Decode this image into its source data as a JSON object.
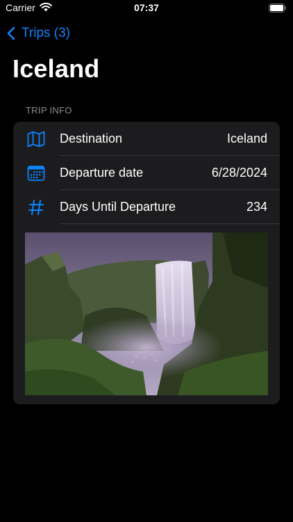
{
  "status_bar": {
    "carrier": "Carrier",
    "time": "07:37"
  },
  "nav": {
    "back_label": "Trips (3)"
  },
  "page": {
    "title": "Iceland"
  },
  "section": {
    "header": "TRIP INFO"
  },
  "info_rows": [
    {
      "icon": "map-icon",
      "label": "Destination",
      "value": "Iceland"
    },
    {
      "icon": "calendar-icon",
      "label": "Departure date",
      "value": "6/28/2024"
    },
    {
      "icon": "hashtag-icon",
      "label": "Days Until Departure",
      "value": "234"
    }
  ],
  "photo": {
    "subject": "waterfall-photo"
  },
  "colors": {
    "accent": "#0a84ff",
    "background": "#000000",
    "card": "#1c1c1e",
    "secondary_text": "#8e8e93"
  }
}
